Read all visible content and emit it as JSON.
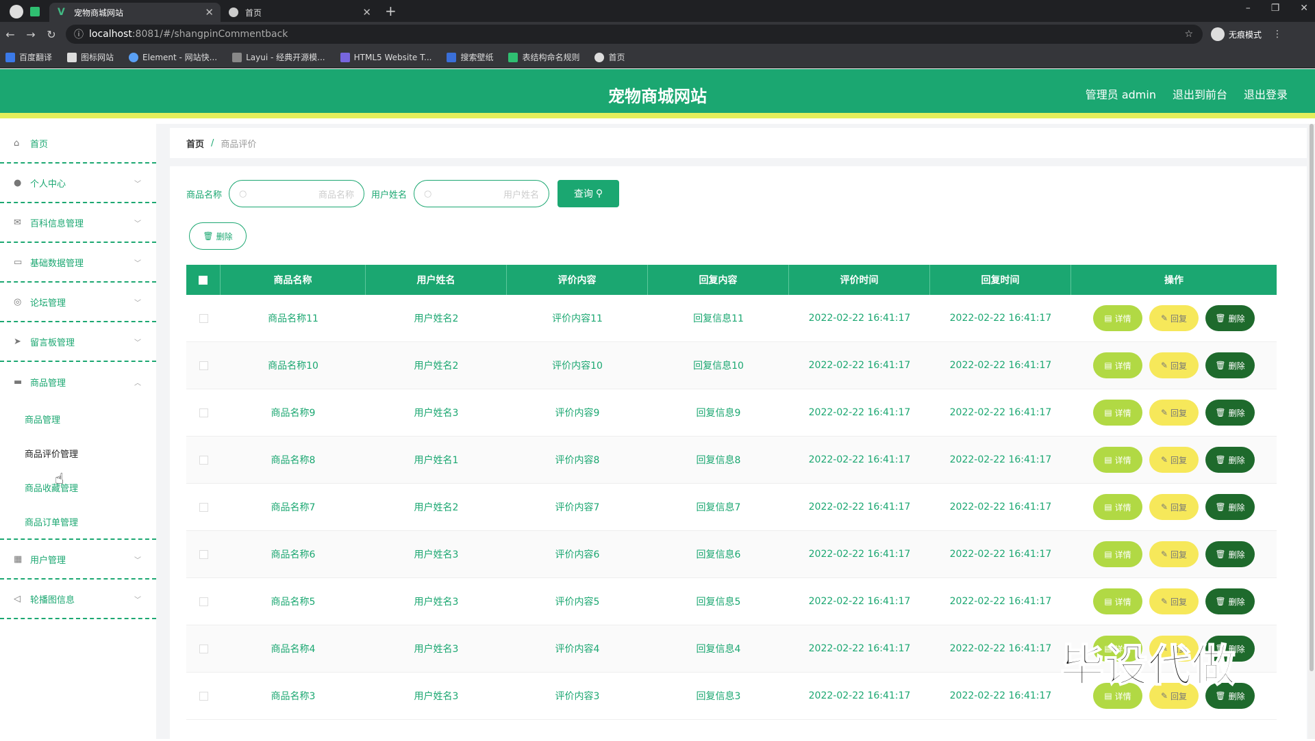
{
  "browser": {
    "tabs": [
      {
        "label": "宠物商城网站",
        "active": true
      },
      {
        "label": "首页",
        "active": false
      }
    ],
    "url_host": "localhost",
    "url_rest": ":8081/#/shangpinCommentback",
    "profile": "无痕模式",
    "bookmarks": [
      "百度翻译",
      "图标网站",
      "Element - 网站快...",
      "Layui - 经典开源模...",
      "HTML5 Website T...",
      "搜索壁纸",
      "表结构命名规则",
      "首页"
    ]
  },
  "header": {
    "title": "宠物商城网站",
    "admin": "管理员 admin",
    "to_front": "退出到前台",
    "logout": "退出登录"
  },
  "sidebar": {
    "items": [
      {
        "label": "首页",
        "icon": "home-icon"
      },
      {
        "label": "个人中心",
        "icon": "user-icon"
      },
      {
        "label": "百科信息管理",
        "icon": "mail-icon"
      },
      {
        "label": "基础数据管理",
        "icon": "chat-icon"
      },
      {
        "label": "论坛管理",
        "icon": "compass-icon"
      },
      {
        "label": "留言板管理",
        "icon": "send-icon"
      },
      {
        "label": "商品管理",
        "icon": "goods-icon"
      }
    ],
    "sub_items": [
      "商品管理",
      "商品评价管理",
      "商品收藏管理",
      "商品订单管理"
    ],
    "items_after": [
      {
        "label": "用户管理",
        "icon": "grid-icon"
      },
      {
        "label": "轮播图信息",
        "icon": "nav-icon"
      }
    ]
  },
  "breadcrumb": {
    "home": "首页",
    "sep": "/",
    "current": "商品评价"
  },
  "search": {
    "product_label": "商品名称",
    "product_placeholder": "商品名称",
    "user_label": "用户姓名",
    "user_placeholder": "用户姓名",
    "query_button": "查询"
  },
  "bulk_delete": "删除",
  "table": {
    "columns": [
      "商品名称",
      "用户姓名",
      "评价内容",
      "回复内容",
      "评价时间",
      "回复时间",
      "操作"
    ],
    "action_labels": {
      "detail": "详情",
      "reply": "回复",
      "delete": "删除"
    },
    "rows": [
      [
        "商品名称11",
        "用户姓名2",
        "评价内容11",
        "回复信息11",
        "2022-02-22 16:41:17",
        "2022-02-22 16:41:17"
      ],
      [
        "商品名称10",
        "用户姓名2",
        "评价内容10",
        "回复信息10",
        "2022-02-22 16:41:17",
        "2022-02-22 16:41:17"
      ],
      [
        "商品名称9",
        "用户姓名3",
        "评价内容9",
        "回复信息9",
        "2022-02-22 16:41:17",
        "2022-02-22 16:41:17"
      ],
      [
        "商品名称8",
        "用户姓名1",
        "评价内容8",
        "回复信息8",
        "2022-02-22 16:41:17",
        "2022-02-22 16:41:17"
      ],
      [
        "商品名称7",
        "用户姓名2",
        "评价内容7",
        "回复信息7",
        "2022-02-22 16:41:17",
        "2022-02-22 16:41:17"
      ],
      [
        "商品名称6",
        "用户姓名3",
        "评价内容6",
        "回复信息6",
        "2022-02-22 16:41:17",
        "2022-02-22 16:41:17"
      ],
      [
        "商品名称5",
        "用户姓名3",
        "评价内容5",
        "回复信息5",
        "2022-02-22 16:41:17",
        "2022-02-22 16:41:17"
      ],
      [
        "商品名称4",
        "用户姓名3",
        "评价内容4",
        "回复信息4",
        "2022-02-22 16:41:17",
        "2022-02-22 16:41:17"
      ],
      [
        "商品名称3",
        "用户姓名3",
        "评价内容3",
        "回复信息3",
        "2022-02-22 16:41:17",
        "2022-02-22 16:41:17"
      ]
    ]
  },
  "watermark": "毕设代做",
  "colors": {
    "primary": "#1ba771",
    "accent_bar": "#e3ef5b",
    "detail": "#b1d944",
    "reply": "#f6e85a",
    "delete": "#1e6a2c"
  }
}
